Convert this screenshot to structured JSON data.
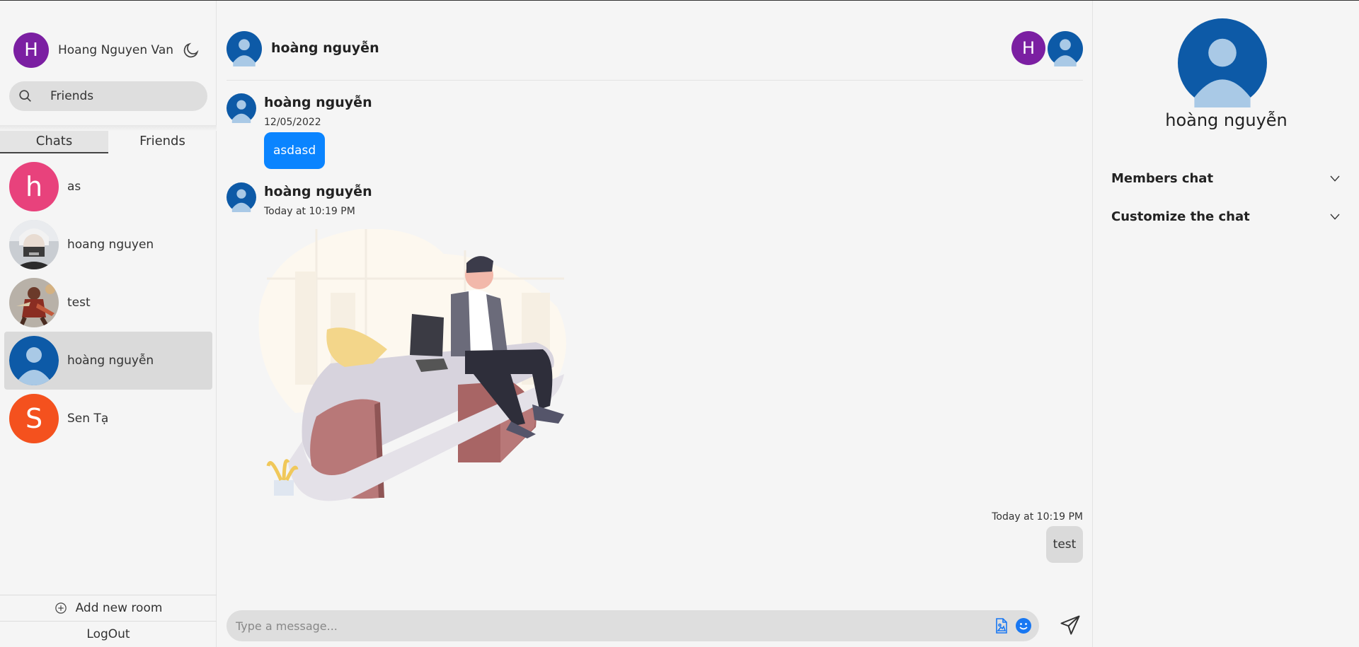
{
  "current_user": {
    "initial": "H",
    "name": "Hoang Nguyen Van"
  },
  "search": {
    "value": "Friends"
  },
  "tabs": [
    {
      "label": "Chats",
      "active": true
    },
    {
      "label": "Friends",
      "active": false
    }
  ],
  "friends": [
    {
      "name": "as",
      "initial": "h",
      "avatar": "letter",
      "color": "#e8427c"
    },
    {
      "name": "hoang nguyen",
      "avatar": "photo-masked-character"
    },
    {
      "name": "test",
      "avatar": "photo-warrior-character"
    },
    {
      "name": "hoàng nguyễn",
      "avatar": "default-person",
      "selected": true
    },
    {
      "name": "Sen Tạ",
      "initial": "S",
      "avatar": "letter",
      "color": "#f4511e"
    }
  ],
  "sidebar_bottom": {
    "add_room": "Add new room",
    "logout": "LogOut"
  },
  "chat": {
    "title": "hoàng nguyễn",
    "header_members": [
      {
        "initial": "H"
      },
      {
        "avatar": "default-person"
      }
    ],
    "messages": [
      {
        "sender": "hoàng nguyễn",
        "time": "12/05/2022",
        "text": "asdasd"
      },
      {
        "sender": "hoàng nguyễn",
        "time": "Today at 10:19 PM",
        "attachment": "illustration-person-sitting-on-desk"
      },
      {
        "mine": true,
        "time": "Today at 10:19 PM",
        "text": "test"
      }
    ],
    "composer": {
      "placeholder": "Type a message..."
    }
  },
  "info_panel": {
    "name": "hoàng nguyễn",
    "sections": [
      {
        "label": "Members chat"
      },
      {
        "label": "Customize the chat"
      }
    ]
  },
  "colors": {
    "accent": "#0a84ff",
    "purple": "#7b1fa2",
    "avatar_blue": "#0d5aa7",
    "avatar_light": "#a9c9e6"
  }
}
